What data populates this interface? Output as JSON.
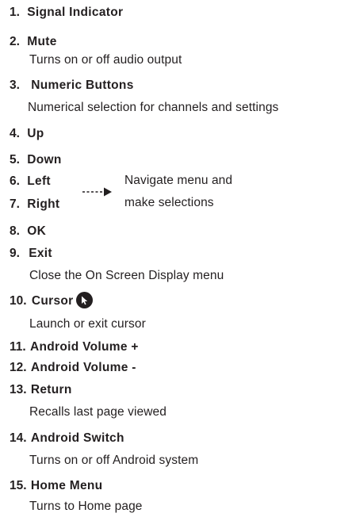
{
  "items": [
    {
      "number": "1.",
      "title": "Signal Indicator"
    },
    {
      "number": "2.",
      "title": "Mute",
      "desc": "Turns on or off audio output"
    },
    {
      "number": "3.",
      "title": "Numeric Buttons",
      "desc": "Numerical selection for channels and settings"
    },
    {
      "number": "4.",
      "title": "Up"
    },
    {
      "number": "5.",
      "title": "Down"
    },
    {
      "number": "6.",
      "title": "Left"
    },
    {
      "number": "7.",
      "title": "Right"
    },
    {
      "number": "8.",
      "title": "OK"
    },
    {
      "number": "9.",
      "title": "Exit",
      "desc": "Close the On Screen Display menu"
    },
    {
      "number": "10.",
      "title": "Cursor",
      "desc": "Launch or exit cursor"
    },
    {
      "number": "11.",
      "title": "Android Volume +"
    },
    {
      "number": "12.",
      "title": "Android Volume -"
    },
    {
      "number": "13.",
      "title": "Return",
      "desc": "Recalls last page viewed"
    },
    {
      "number": "14.",
      "title": "Android Switch",
      "desc": "Turns on or off Android system"
    },
    {
      "number": "15.",
      "title": "Home Menu",
      "desc": "Turns to Home page"
    }
  ],
  "navigate_note": {
    "line1": "Navigate menu and",
    "line2": "make selections"
  },
  "icons": {
    "cursor": "cursor-pointer-icon",
    "arrow": "dotted-arrow-icon"
  },
  "colors": {
    "text": "#231f20",
    "icon_fill": "#231f20"
  }
}
